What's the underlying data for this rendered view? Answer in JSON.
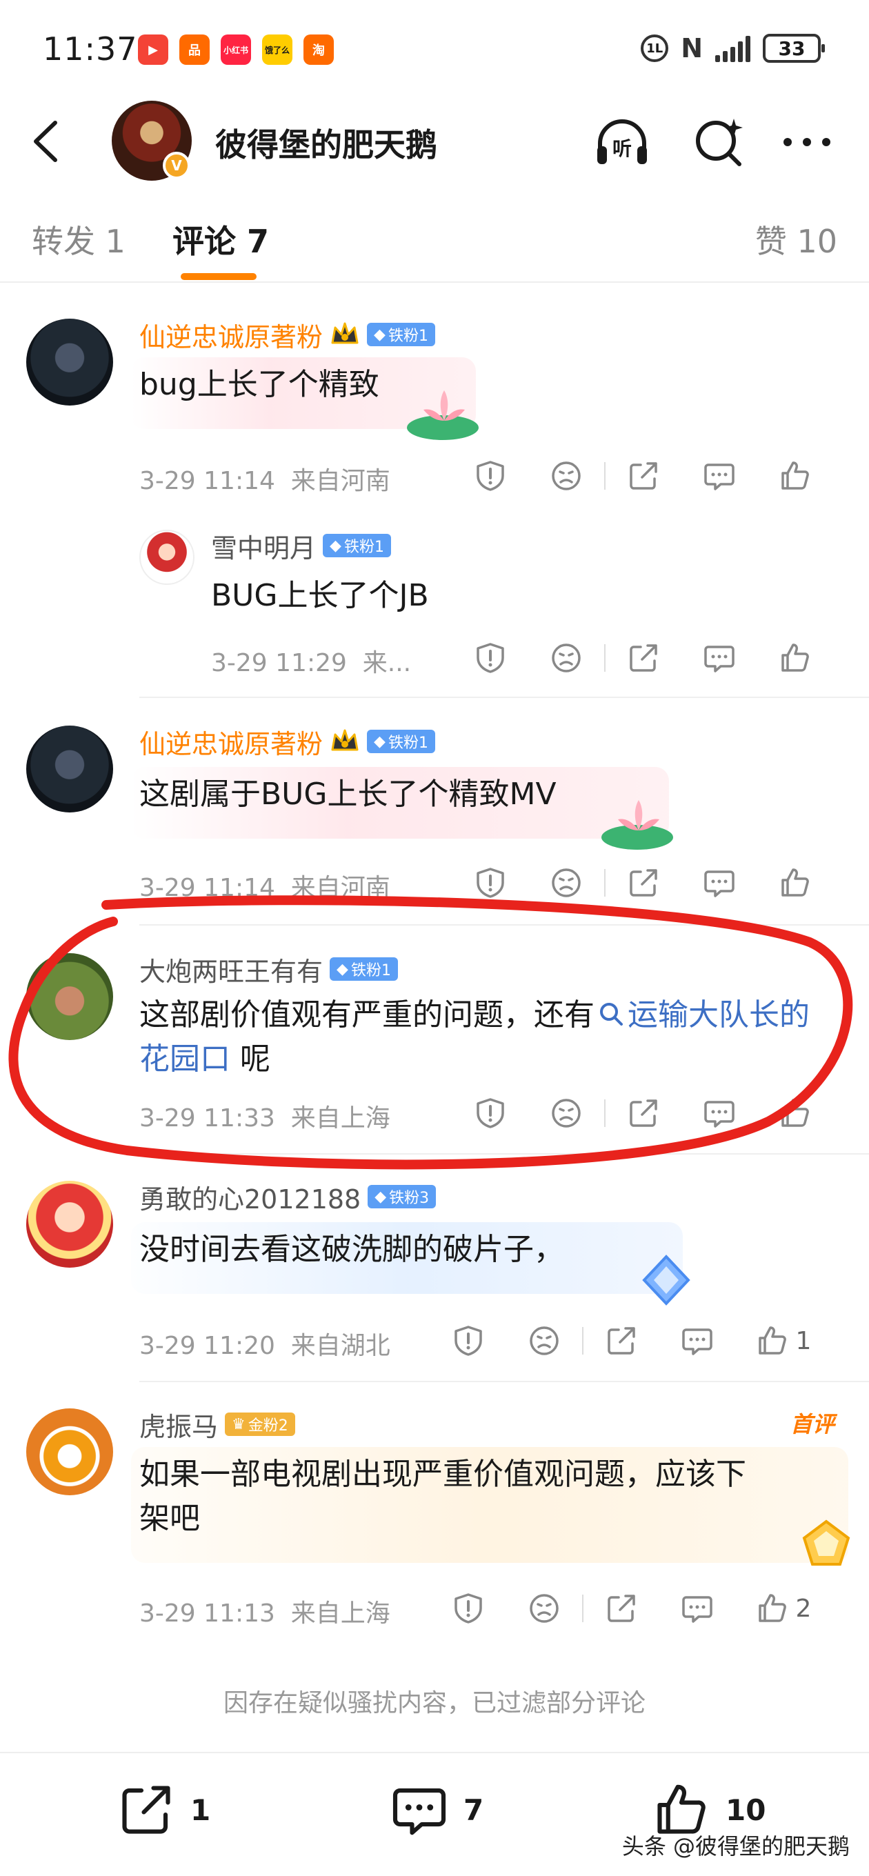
{
  "status_bar": {
    "time": "11:37",
    "apps": [
      {
        "name": "video-app",
        "color": "#f44336",
        "glyph": "▶"
      },
      {
        "name": "orange-app",
        "color": "#ff6a00",
        "glyph": "品"
      },
      {
        "name": "xiaohongshu-app",
        "color": "#ff2442",
        "glyph": "小红书"
      },
      {
        "name": "eleme-app",
        "color": "#ffcc00",
        "glyph": "饿了么"
      },
      {
        "name": "taobao-app",
        "color": "#ff6a00",
        "glyph": "淘"
      }
    ],
    "circle_icon": "1L",
    "nfc": "N",
    "battery": "33"
  },
  "header": {
    "title": "彼得堡的肥天鹅",
    "verify_mark": "V",
    "listen_label": "听"
  },
  "tabs": {
    "repost": "转发 1",
    "comment": "评论 7",
    "like": "赞 10"
  },
  "comments": [
    {
      "name": "仙逆忠诚原著粉",
      "fan_badge": "铁粉1",
      "text": "bug上长了个精致",
      "time": "3-29 11:14",
      "location": "来自河南",
      "reply": {
        "name": "雪中明月",
        "fan_badge": "铁粉1",
        "text": "BUG上长了个JB",
        "time": "3-29 11:29",
        "location": "来..."
      }
    },
    {
      "name": "仙逆忠诚原著粉",
      "fan_badge": "铁粉1",
      "text": "这剧属于BUG上长了个精致MV",
      "time": "3-29 11:14",
      "location": "来自河南"
    },
    {
      "name": "大炮两旺王有有",
      "fan_badge": "铁粉1",
      "text_prefix": "这部剧价值观有严重的问题，还有",
      "link_text": "运输大队长的花园口",
      "text_suffix": "呢",
      "time": "3-29 11:33",
      "location": "来自上海"
    },
    {
      "name": "勇敢的心2012188",
      "fan_badge": "铁粉3",
      "text": "没时间去看这破洗脚的破片子，",
      "time": "3-29 11:20",
      "location": "来自湖北",
      "likes": "1"
    },
    {
      "name": "虎振马",
      "fan_badge": "金粉2",
      "tag": "首评",
      "text_line1": "如果一部电视剧出现严重价值观问题，应该下",
      "text_line2": "架吧",
      "time": "3-29 11:13",
      "location": "来自上海",
      "likes": "2"
    }
  ],
  "filter_notice": "因存在疑似骚扰内容，已过滤部分评论",
  "bottom_bar": {
    "repost_count": "1",
    "comment_count": "7",
    "like_count": "10"
  },
  "watermark": "头条 @彼得堡的肥天鹅",
  "colors": {
    "accent": "#ff8200",
    "link": "#3d6fc4",
    "annotation_red": "#e8231c"
  }
}
